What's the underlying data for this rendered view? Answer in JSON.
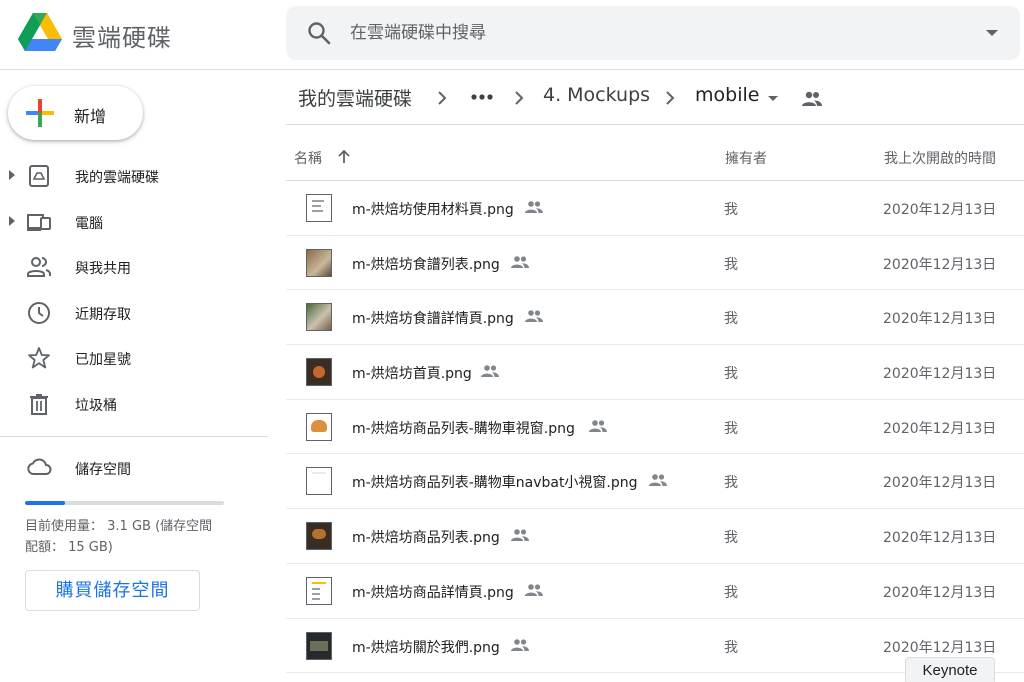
{
  "app": {
    "title": "雲端硬碟"
  },
  "search": {
    "placeholder": "在雲端硬碟中搜尋"
  },
  "sidebar": {
    "new_label": "新增",
    "items": [
      {
        "label": "我的雲端硬碟",
        "icon": "my-drive-icon"
      },
      {
        "label": "電腦",
        "icon": "computers-icon"
      },
      {
        "label": "與我共用",
        "icon": "shared-with-me-icon"
      },
      {
        "label": "近期存取",
        "icon": "recent-icon"
      },
      {
        "label": "已加星號",
        "icon": "starred-icon"
      },
      {
        "label": "垃圾桶",
        "icon": "trash-icon"
      }
    ],
    "storage": {
      "label": "儲存空間",
      "usage_fraction": 0.2,
      "usage_text": "目前使用量： 3.1 GB (儲存空間配額： 15 GB)",
      "buy_label": "購買儲存空間"
    }
  },
  "breadcrumb": {
    "root": "我的雲端硬碟",
    "more": "•••",
    "parent": "4. Mockups",
    "current": "mobile"
  },
  "columns": {
    "name": "名稱",
    "owner": "擁有者",
    "opened": "我上次開啟的時間"
  },
  "files": [
    {
      "name": "m-烘焙坊使用材料頁.png",
      "owner": "我",
      "opened": "2020年12月13日",
      "thumb": "doc"
    },
    {
      "name": "m-烘焙坊食譜列表.png",
      "owner": "我",
      "opened": "2020年12月13日",
      "thumb": "photo"
    },
    {
      "name": "m-烘焙坊食譜詳情頁.png",
      "owner": "我",
      "opened": "2020年12月13日",
      "thumb": "green"
    },
    {
      "name": "m-烘焙坊首頁.png",
      "owner": "我",
      "opened": "2020年12月13日",
      "thumb": "dark"
    },
    {
      "name": "m-烘焙坊商品列表-購物車視窗.png",
      "owner": "我",
      "opened": "2020年12月13日",
      "thumb": "burger"
    },
    {
      "name": "m-烘焙坊商品列表-購物車navbat小視窗.png",
      "owner": "我",
      "opened": "2020年12月13日",
      "thumb": "doc"
    },
    {
      "name": "m-烘焙坊商品列表.png",
      "owner": "我",
      "opened": "2020年12月13日",
      "thumb": "dark"
    },
    {
      "name": "m-烘焙坊商品詳情頁.png",
      "owner": "我",
      "opened": "2020年12月13日",
      "thumb": "doc"
    },
    {
      "name": "m-烘焙坊關於我們.png",
      "owner": "我",
      "opened": "2020年12月13日",
      "thumb": "gray"
    }
  ],
  "tooltip": "Keynote",
  "colors": {
    "accent": "#1a73e8",
    "text": "#202124",
    "muted": "#5f6368",
    "divider": "#dadce0"
  }
}
